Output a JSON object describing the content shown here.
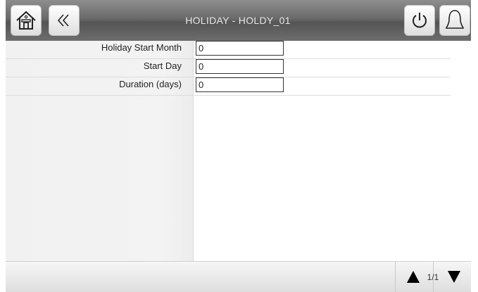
{
  "header": {
    "title": "HOLIDAY - HOLDY_01",
    "icons": {
      "home": "home-icon",
      "back": "double-chevron-left-icon",
      "power": "power-icon",
      "alarm": "bell-icon"
    }
  },
  "form": {
    "rows": [
      {
        "label": "Holiday Start Month",
        "value": "0"
      },
      {
        "label": "Start Day",
        "value": "0"
      },
      {
        "label": "Duration (days)",
        "value": "0"
      }
    ]
  },
  "footer": {
    "page_indicator": "1/1"
  }
}
